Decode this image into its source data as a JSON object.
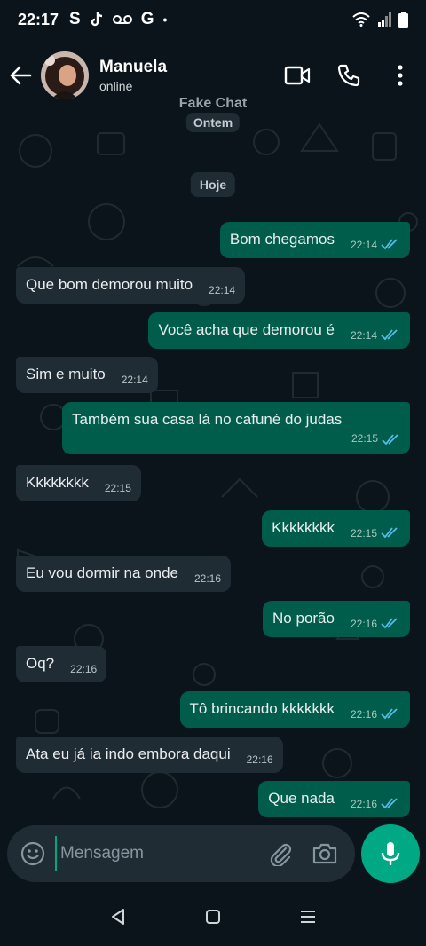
{
  "status_bar": {
    "time": "22:17",
    "left_icons": [
      "S",
      "tiktok-icon",
      "voicemail-icon",
      "G",
      "•"
    ],
    "right_icons": [
      "wifi-icon",
      "signal-icon",
      "battery-icon"
    ]
  },
  "header": {
    "contact_name": "Manuela",
    "contact_status": "online",
    "actions": [
      "video-call-icon",
      "voice-call-icon",
      "more-options-icon"
    ]
  },
  "watermark": "Fake Chat",
  "date_chips": {
    "yesterday": "Ontem",
    "today": "Hoje"
  },
  "messages": [
    {
      "dir": "out",
      "text": "Bom chegamos",
      "time": "22:14",
      "read": true
    },
    {
      "dir": "in",
      "text": "Que bom demorou muito",
      "time": "22:14"
    },
    {
      "dir": "out",
      "text": "Você acha que demorou é",
      "time": "22:14",
      "read": true
    },
    {
      "dir": "in",
      "text": "Sim e muito",
      "time": "22:14"
    },
    {
      "dir": "out",
      "text": "Também sua casa lá no cafuné do judas",
      "time": "22:15",
      "read": true
    },
    {
      "dir": "in",
      "text": "Kkkkkkkk",
      "time": "22:15"
    },
    {
      "dir": "out",
      "text": "Kkkkkkkk",
      "time": "22:15",
      "read": true
    },
    {
      "dir": "in",
      "text": "Eu vou dormir na onde",
      "time": "22:16"
    },
    {
      "dir": "out",
      "text": "No porão",
      "time": "22:16",
      "read": true
    },
    {
      "dir": "in",
      "text": "Oq?",
      "time": "22:16"
    },
    {
      "dir": "out",
      "text": "Tô brincando kkkkkkk",
      "time": "22:16",
      "read": true
    },
    {
      "dir": "in",
      "text": "Ata eu já ia indo embora daqui",
      "time": "22:16"
    },
    {
      "dir": "out",
      "text": "Que nada",
      "time": "22:16",
      "read": true
    }
  ],
  "input": {
    "placeholder": "Mensagem"
  },
  "colors": {
    "background": "#0b141a",
    "incoming": "#202c33",
    "outgoing": "#005c4b",
    "accent": "#00a884",
    "read_ticks": "#53bdeb"
  },
  "nav_bar": [
    "back-nav-icon",
    "home-nav-icon",
    "recents-nav-icon"
  ]
}
